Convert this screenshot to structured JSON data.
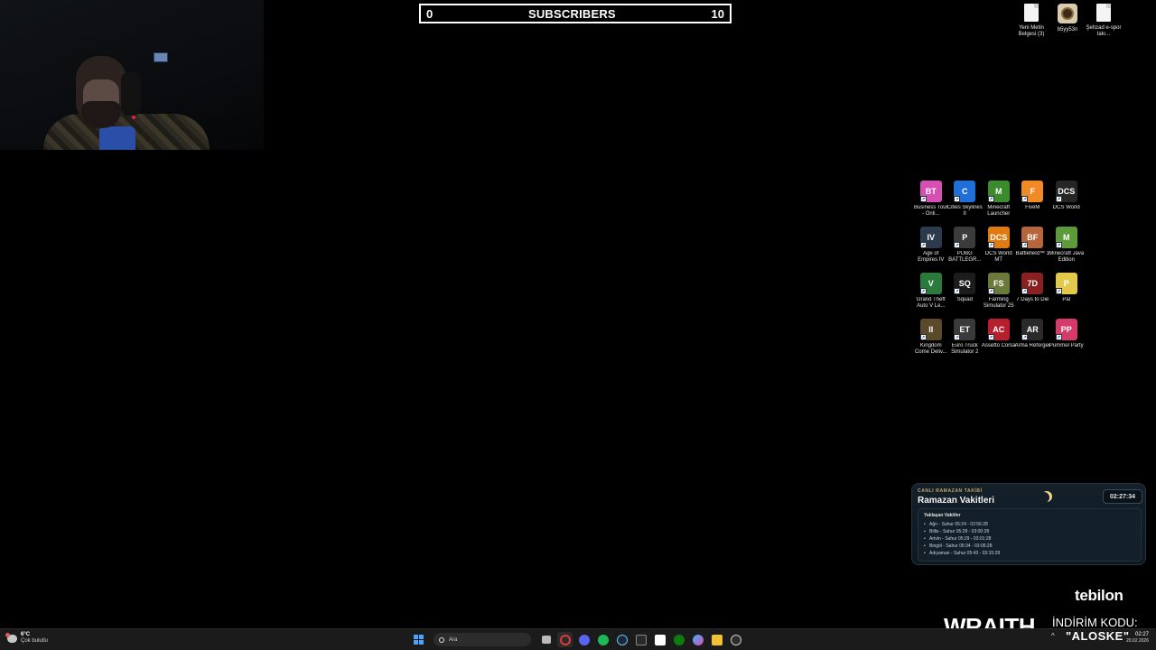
{
  "subscriber_bar": {
    "current": "0",
    "label": "SUBSCRIBERS",
    "goal": "10"
  },
  "desktop_files": [
    {
      "label": "Yeni Metin Belgesi (3)",
      "icon": "text-file-icon"
    },
    {
      "label": "b5yy53n",
      "icon": "avatar-image-icon"
    },
    {
      "label": "Şehzad e-spor takı...",
      "icon": "text-file-icon"
    }
  ],
  "apps": [
    {
      "label": "Business Tour - Onli...",
      "short": "BT",
      "color": "#d64fb3"
    },
    {
      "label": "Cities Skylines II",
      "short": "C",
      "color": "#1f6fd8"
    },
    {
      "label": "Minecraft Launcher",
      "short": "M",
      "color": "#3c8a2e"
    },
    {
      "label": "FiveM",
      "short": "F",
      "color": "#f08a24"
    },
    {
      "label": "DCS World",
      "short": "DCS",
      "color": "#262626"
    },
    {
      "label": "Age of Empires IV",
      "short": "IV",
      "color": "#2c3a4e"
    },
    {
      "label": "PUBG BATTLEGR...",
      "short": "P",
      "color": "#3b3b3b"
    },
    {
      "label": "DCS World MT",
      "short": "DCS",
      "color": "#e07b12"
    },
    {
      "label": "Battlefield™ 1",
      "short": "BF",
      "color": "#b7653a"
    },
    {
      "label": "Minecraft Java Edition",
      "short": "M",
      "color": "#5c9a3a"
    },
    {
      "label": "Grand Theft Auto V Le...",
      "short": "V",
      "color": "#2a7a3b"
    },
    {
      "label": "Squad",
      "short": "SQ",
      "color": "#1c1c1c"
    },
    {
      "label": "Farming Simulator 25",
      "short": "FS",
      "color": "#6a7a3a"
    },
    {
      "label": "7 Days to Die",
      "short": "7D",
      "color": "#8a2020"
    },
    {
      "label": "Pal",
      "short": "P",
      "color": "#e2c94a"
    },
    {
      "label": "Kingdom Come Deliv...",
      "short": "II",
      "color": "#5a4a2a"
    },
    {
      "label": "Euro Truck Simulator 2",
      "short": "ET",
      "color": "#3a3a3a"
    },
    {
      "label": "Assetto Corsa",
      "short": "AC",
      "color": "#b81f2e"
    },
    {
      "label": "Arma Reforger",
      "short": "AR",
      "color": "#2a2a2a"
    },
    {
      "label": "Pummel Party",
      "short": "PP",
      "color": "#d63a6a"
    }
  ],
  "ramazan": {
    "subtitle": "CANLI RAMAZAN TAKİBİ",
    "title": "Ramazan Vakitleri",
    "timer": "02:27:34",
    "list_title": "Yaklaşan Vakitler",
    "items": [
      "Ağrı - Sahur 05:24 - 02:56:28",
      "Bitlis - Sahur 05:28 - 03:00:28",
      "Artvin - Sahur 05:29 - 03:01:28",
      "Bingöl - Sahur 05:34 - 03:06:28",
      "Adıyaman - Sahur 05:43 - 03:15:28"
    ]
  },
  "sponsor": {
    "tebilon": "tebilon",
    "wraith": "WRAITH.",
    "discount_label": "İNDİRİM KODU:",
    "code": "\"ALOSKE\""
  },
  "taskbar": {
    "weather_temp": "6°C",
    "weather_condition": "Çok bulutlu",
    "search_placeholder": "Ara",
    "time": "02:27",
    "date": "20.02.2026",
    "tray_chevron": "^"
  }
}
